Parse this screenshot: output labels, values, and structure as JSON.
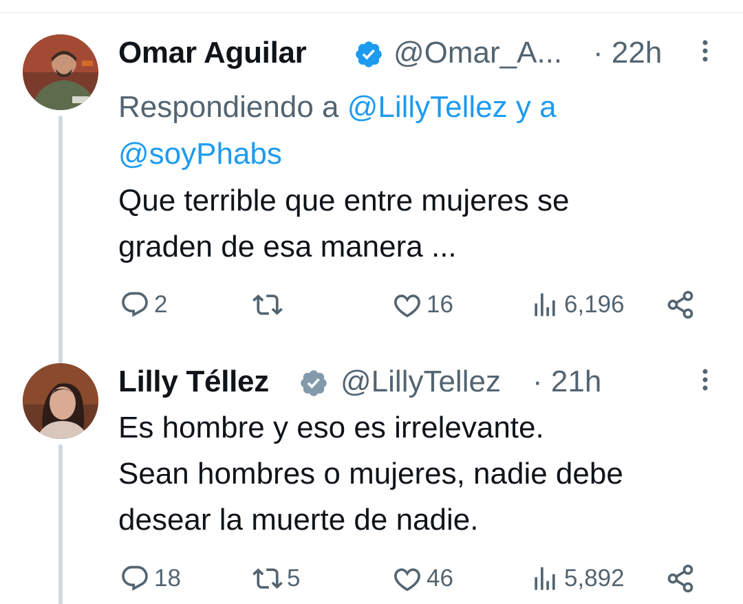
{
  "tweets": [
    {
      "name": "Omar Aguilar",
      "handle": "@Omar_A...",
      "time": "· 22h",
      "reply_prefix": "Respondiendo a ",
      "reply_mention_1": "@LillyTellez",
      "reply_joiner": " y a",
      "reply_mention_2": "@soyPhabs",
      "text_line_1": "Que terrible que entre mujeres se",
      "text_line_2": "graden de esa manera ...",
      "replies": "2",
      "retweets": "",
      "likes": "16",
      "views": "6,196",
      "verified_color": "#1d9bf0"
    },
    {
      "name": "Lilly Téllez",
      "handle": "@LillyTellez",
      "time": "· 21h",
      "text_line_1": "Es hombre y eso es irrelevante.",
      "text_line_2": "Sean hombres o mujeres, nadie debe",
      "text_line_3": "desear la muerte de nadie.",
      "replies": "18",
      "retweets": "5",
      "likes": "46",
      "views": "5,892",
      "verified_color": "#829aab"
    }
  ],
  "colors": {
    "text": "#0f1419",
    "secondary": "#536471",
    "link": "#1d9bf0",
    "thread_line": "#cfd9de"
  }
}
